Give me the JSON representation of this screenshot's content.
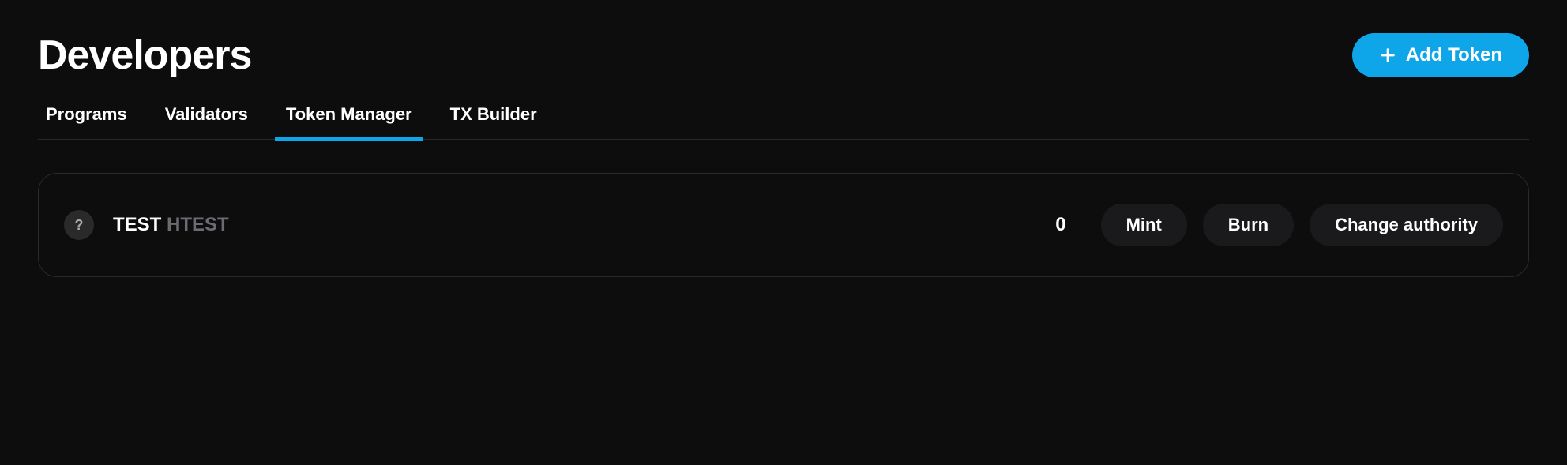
{
  "header": {
    "title": "Developers",
    "add_button_label": "Add Token"
  },
  "tabs": [
    {
      "label": "Programs",
      "active": false
    },
    {
      "label": "Validators",
      "active": false
    },
    {
      "label": "Token Manager",
      "active": true
    },
    {
      "label": "TX Builder",
      "active": false
    }
  ],
  "token": {
    "icon_char": "?",
    "name": "TEST",
    "symbol": "HTEST",
    "amount": "0",
    "actions": {
      "mint": "Mint",
      "burn": "Burn",
      "change_authority": "Change authority"
    }
  }
}
